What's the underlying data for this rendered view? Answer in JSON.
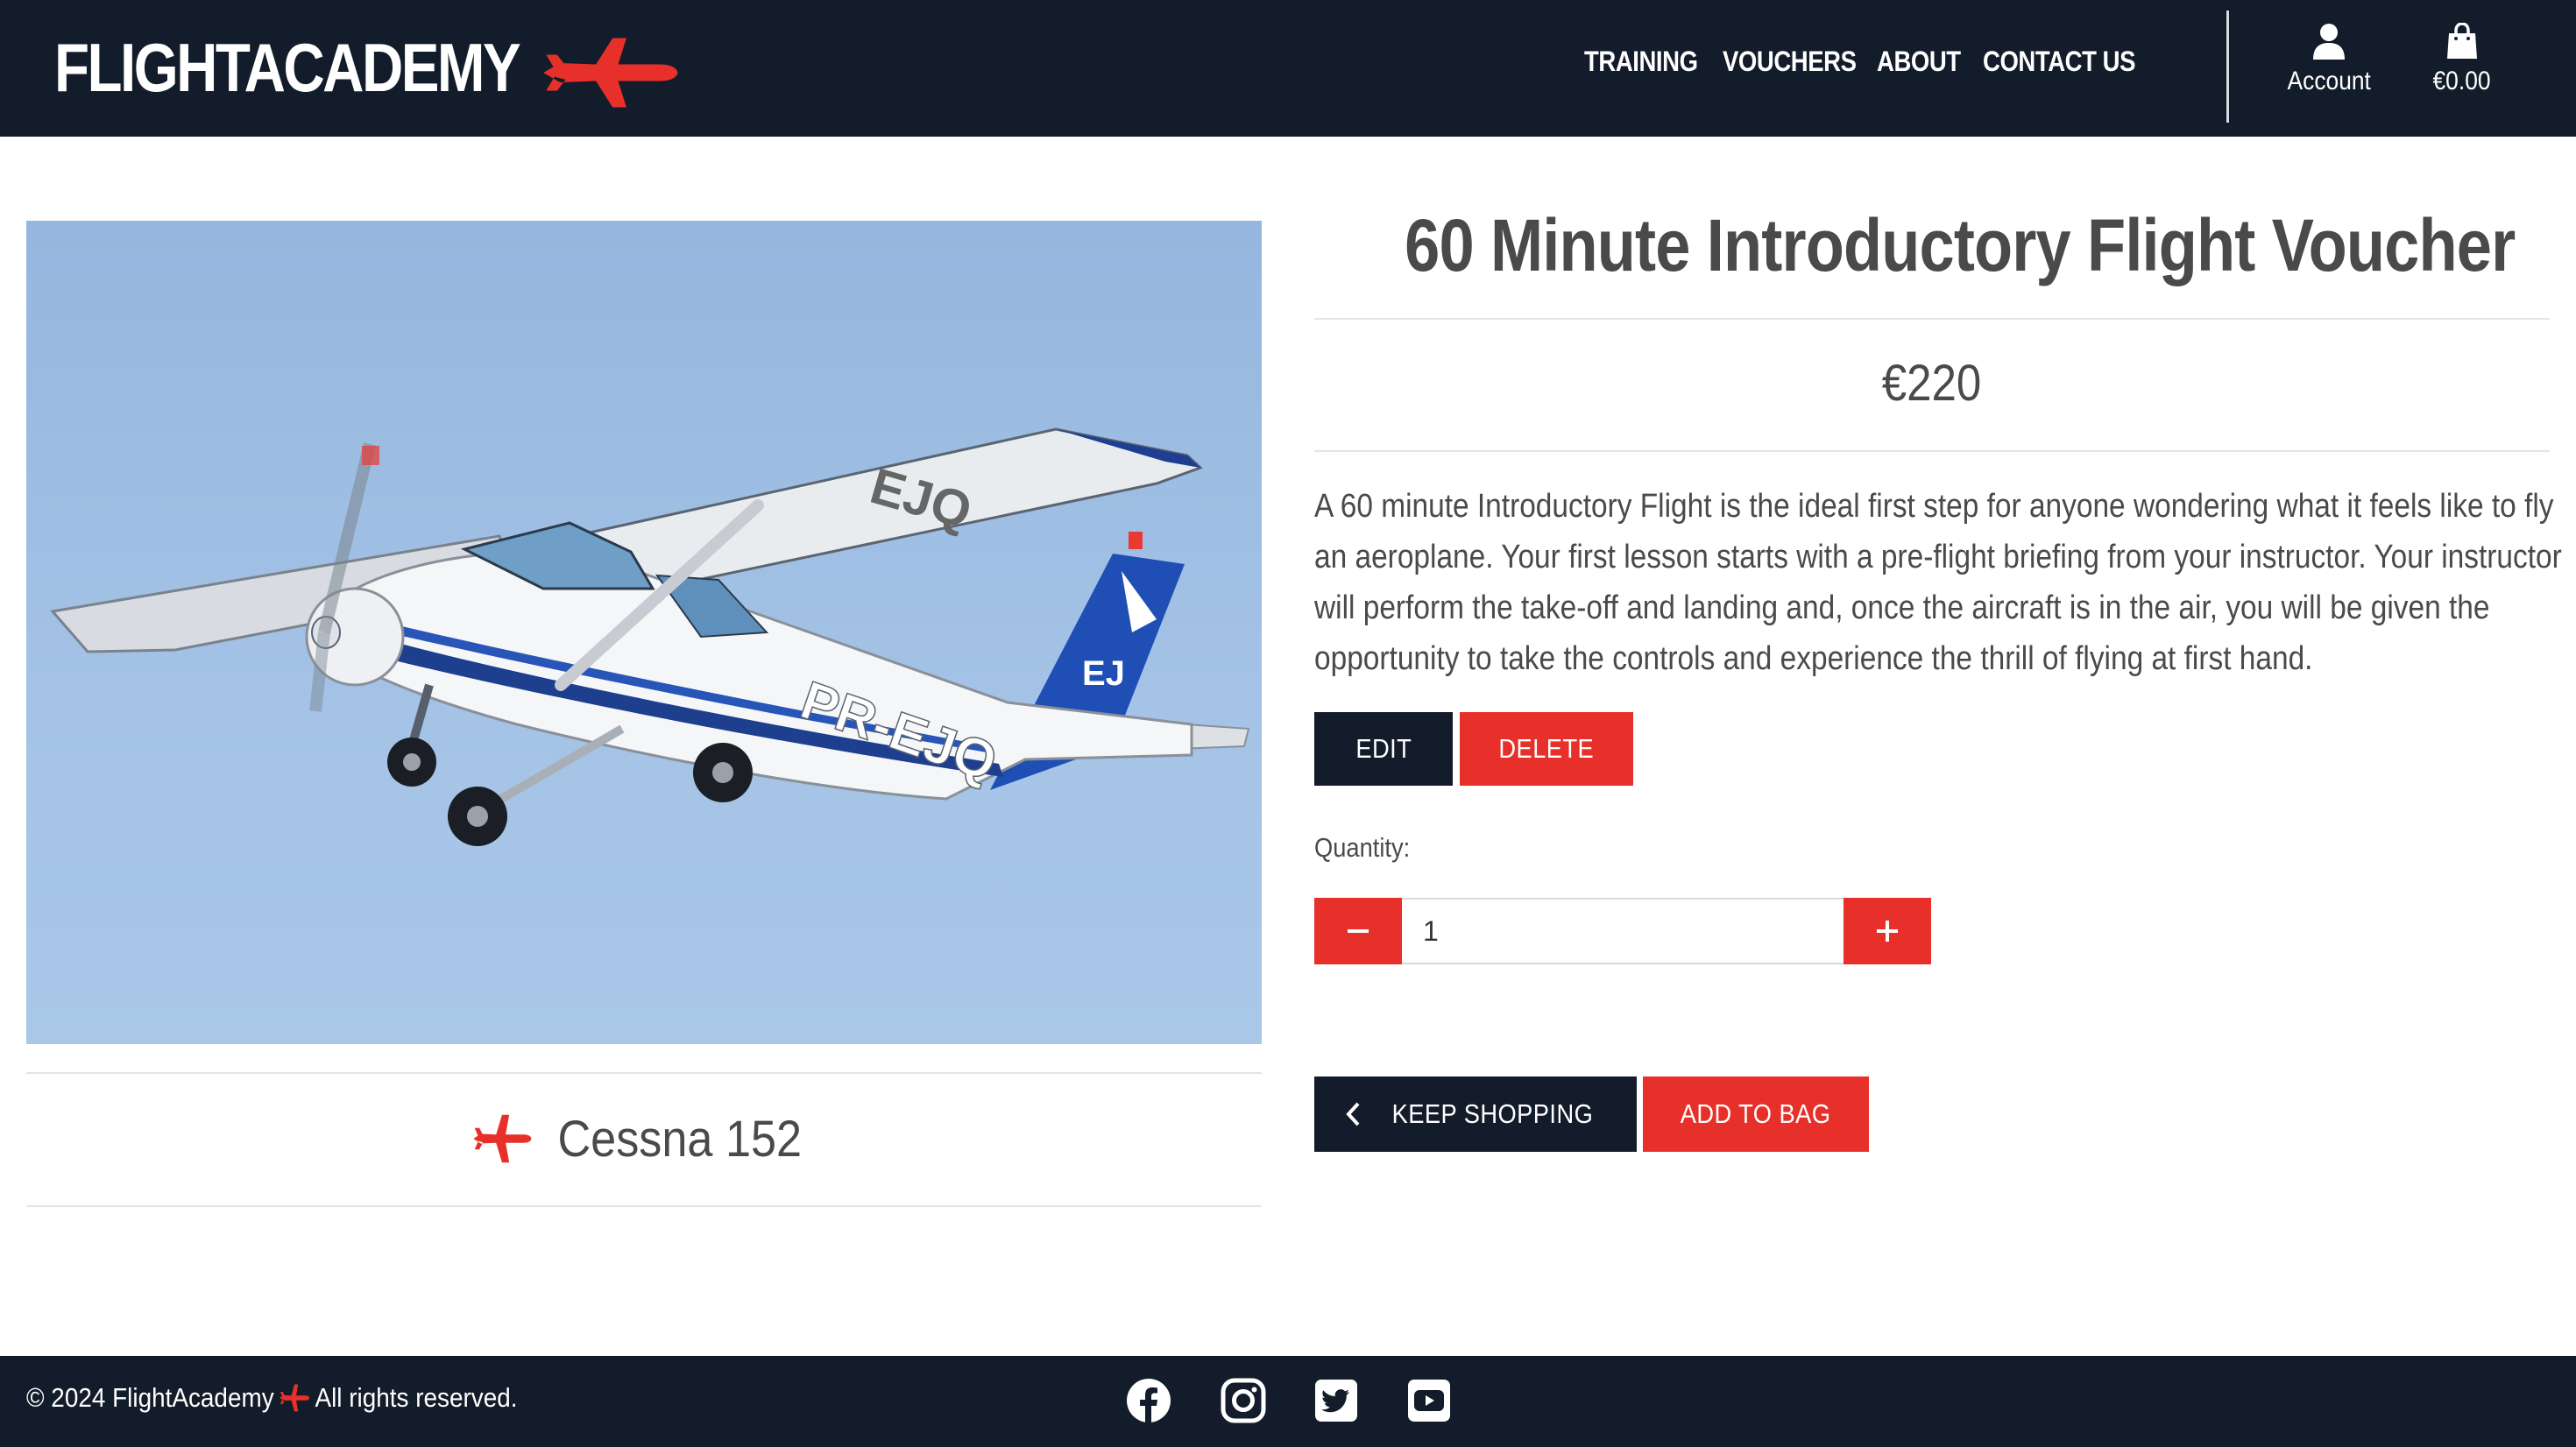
{
  "header": {
    "logo_text": "FLIGHTACADEMY",
    "nav": [
      {
        "label": "TRAINING"
      },
      {
        "label": "VOUCHERS"
      },
      {
        "label": "ABOUT"
      },
      {
        "label": "CONTACT US"
      }
    ],
    "account_label": "Account",
    "bag_total": "€0.00"
  },
  "product": {
    "image_caption": "Cessna 152",
    "title": "60 Minute Introductory Flight Voucher",
    "price": "€220",
    "description": "A 60 minute Introductory Flight is the ideal first step for anyone wondering what it feels like to fly an aeroplane. Your first lesson starts with a pre-flight briefing from your instructor. Your instructor will perform the take-off and landing and, once the aircraft is in the air, you will be given the opportunity to take the controls and experience the thrill of flying at first hand.",
    "aircraft_registration": "PR-EJQ",
    "tail_marking": "EJ"
  },
  "admin": {
    "edit_label": "EDIT",
    "delete_label": "DELETE"
  },
  "quantity": {
    "label": "Quantity:",
    "value": "1",
    "minus_icon": "minus-icon",
    "plus_icon": "plus-icon"
  },
  "actions": {
    "keep_shopping_label": "KEEP SHOPPING",
    "add_to_bag_label": "ADD TO BAG"
  },
  "footer": {
    "copyright_prefix": "© 2024 FlightAcademy",
    "copyright_suffix": "All rights reserved.",
    "social": [
      "facebook-icon",
      "instagram-icon",
      "twitter-icon",
      "youtube-icon"
    ]
  },
  "colors": {
    "navy": "#131c2a",
    "accent_red": "#e8302a",
    "text": "#4a4a4a",
    "sky": "#a4c3e6"
  }
}
